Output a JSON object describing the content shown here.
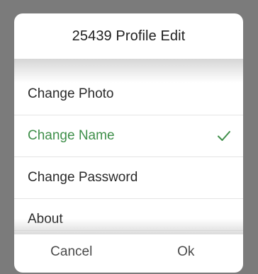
{
  "dialog": {
    "title": "25439 Profile Edit",
    "items": [
      {
        "label": "Change Photo",
        "selected": false
      },
      {
        "label": "Change Name",
        "selected": true
      },
      {
        "label": "Change Password",
        "selected": false
      },
      {
        "label": "About",
        "selected": false
      }
    ],
    "cancel_label": "Cancel",
    "ok_label": "Ok"
  },
  "colors": {
    "overlay": "#7b7b7b",
    "selected": "#3f8f4a",
    "text": "#2a2a2a"
  }
}
